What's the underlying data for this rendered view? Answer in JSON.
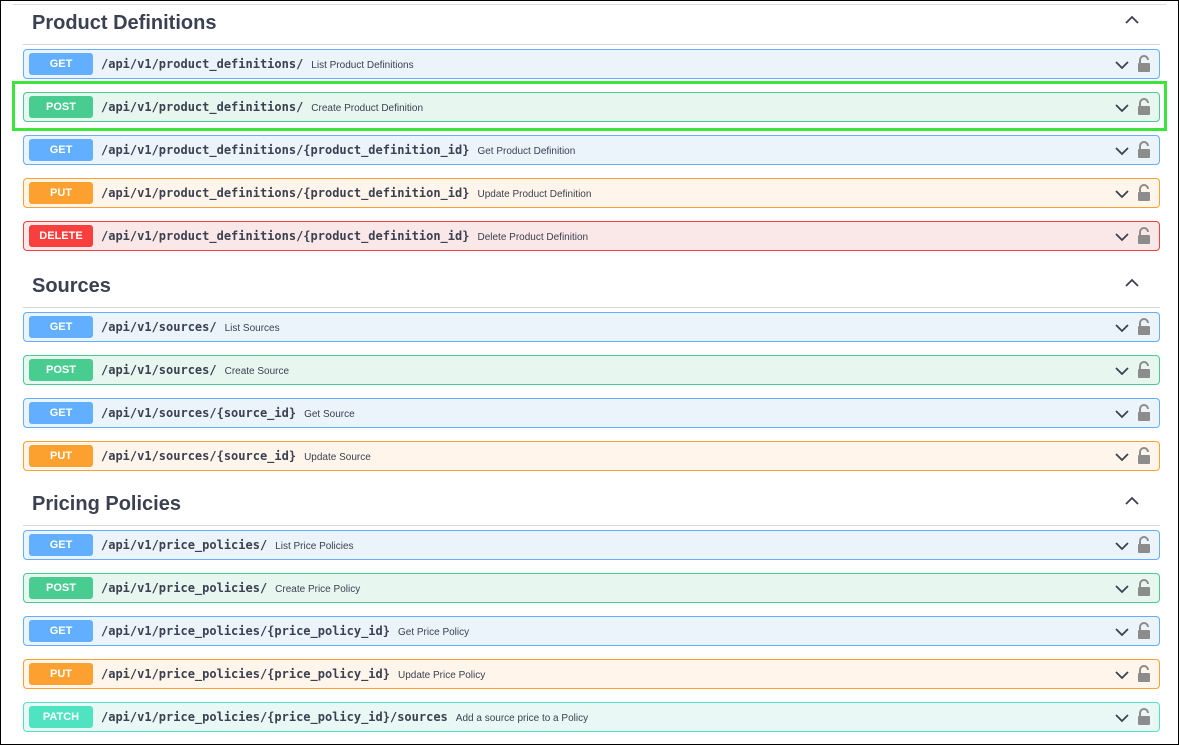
{
  "sections": [
    {
      "title": "Product Definitions",
      "ops": [
        {
          "method": "GET",
          "path": "/api/v1/product_definitions/",
          "summary": "List Product Definitions"
        },
        {
          "method": "POST",
          "path": "/api/v1/product_definitions/",
          "summary": "Create Product Definition"
        },
        {
          "method": "GET",
          "path": "/api/v1/product_definitions/{product_definition_id}",
          "summary": "Get Product Definition"
        },
        {
          "method": "PUT",
          "path": "/api/v1/product_definitions/{product_definition_id}",
          "summary": "Update Product Definition"
        },
        {
          "method": "DELETE",
          "path": "/api/v1/product_definitions/{product_definition_id}",
          "summary": "Delete Product Definition"
        }
      ]
    },
    {
      "title": "Sources",
      "ops": [
        {
          "method": "GET",
          "path": "/api/v1/sources/",
          "summary": "List Sources"
        },
        {
          "method": "POST",
          "path": "/api/v1/sources/",
          "summary": "Create Source"
        },
        {
          "method": "GET",
          "path": "/api/v1/sources/{source_id}",
          "summary": "Get Source"
        },
        {
          "method": "PUT",
          "path": "/api/v1/sources/{source_id}",
          "summary": "Update Source"
        }
      ]
    },
    {
      "title": "Pricing Policies",
      "ops": [
        {
          "method": "GET",
          "path": "/api/v1/price_policies/",
          "summary": "List Price Policies"
        },
        {
          "method": "POST",
          "path": "/api/v1/price_policies/",
          "summary": "Create Price Policy"
        },
        {
          "method": "GET",
          "path": "/api/v1/price_policies/{price_policy_id}",
          "summary": "Get Price Policy"
        },
        {
          "method": "PUT",
          "path": "/api/v1/price_policies/{price_policy_id}",
          "summary": "Update Price Policy"
        },
        {
          "method": "PATCH",
          "path": "/api/v1/price_policies/{price_policy_id}/sources",
          "summary": "Add a source price to a Policy"
        }
      ]
    }
  ],
  "colors": {
    "get": "#61affe",
    "post": "#49cc90",
    "put": "#fca130",
    "delete": "#f93e3e",
    "patch": "#50e3c2",
    "highlight": "#39e639"
  },
  "icons": {
    "section_toggle": "chevron-up-icon",
    "op_toggle": "chevron-down-icon",
    "auth": "unlocked-padlock-icon"
  }
}
